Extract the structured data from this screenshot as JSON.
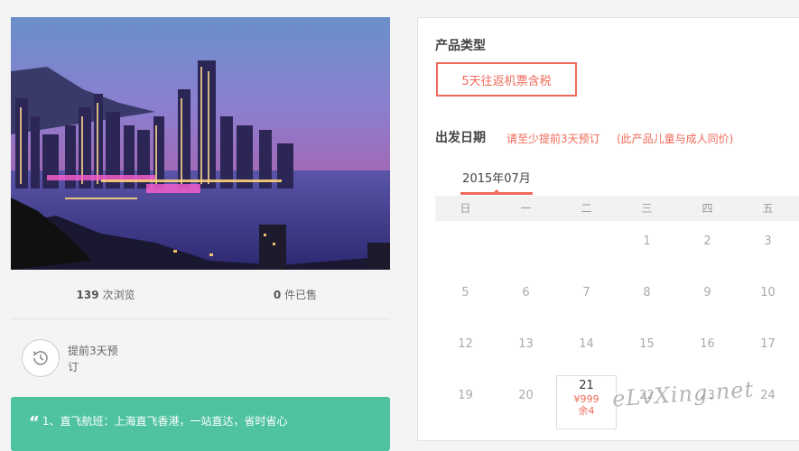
{
  "stats": {
    "views_count": "139",
    "views_label": "次浏览",
    "sold_count": "0",
    "sold_label": "件已售"
  },
  "advance_booking": {
    "icon": "clock-history-icon",
    "text": "提前3天预订"
  },
  "feature": {
    "quote_mark": "“",
    "text": "1、直飞航班：上海直飞香港，一站直达，省时省心"
  },
  "product_type": {
    "title": "产品类型",
    "option": "5天往返机票含税"
  },
  "departure": {
    "title": "出发日期",
    "hint_advance": "请至少提前3天预订",
    "hint_child": "(此产品儿童与成人同价)"
  },
  "calendar": {
    "month_tab": "2015年07月",
    "weekdays": [
      "日",
      "一",
      "二",
      "三",
      "四",
      "五"
    ],
    "rows": [
      [
        "",
        "",
        "",
        "1",
        "2",
        "3"
      ],
      [
        "5",
        "6",
        "7",
        "8",
        "9",
        "10"
      ],
      [
        "12",
        "13",
        "14",
        "15",
        "16",
        "17"
      ],
      [
        "19",
        "20",
        "21",
        "22",
        "23",
        "24"
      ]
    ],
    "selected": {
      "day": "21",
      "price": "¥999",
      "remaining": "余4"
    }
  },
  "watermark": "eLvXing.net",
  "colors": {
    "accent": "#ef6a5a",
    "feature_bg": "#4fc3a0",
    "page_bg": "#f4f4f4"
  }
}
